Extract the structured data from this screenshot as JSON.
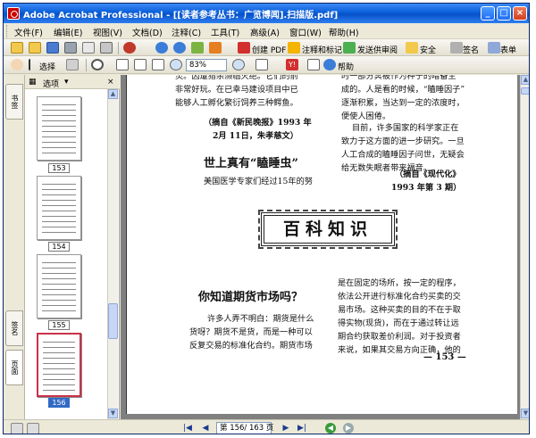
{
  "window": {
    "title": "Adobe Acrobat Professional - [[读者参考丛书：广览博闻].扫描版.pdf]",
    "controls": {
      "minimize": "_",
      "maximize": "□",
      "close": "×"
    }
  },
  "menubar": {
    "items": [
      "文件(F)",
      "编辑(E)",
      "视图(V)",
      "文档(D)",
      "注释(C)",
      "工具(T)",
      "高级(A)",
      "窗口(W)",
      "帮助(H)"
    ]
  },
  "toolbar1": {
    "create_pdf": "创建 PDF",
    "comment_markup": "注释和标记",
    "send_review": "发送供审阅",
    "security": "安全",
    "sign": "签名",
    "forms": "表单"
  },
  "toolbar2": {
    "select_label": "选择",
    "zoom": "83%",
    "help_label": "帮助"
  },
  "sidebar": {
    "tabs": [
      "书签",
      "签名",
      "页面"
    ],
    "options_label": "选项",
    "close": "×",
    "thumbnails": [
      {
        "label": "153"
      },
      {
        "label": "154"
      },
      {
        "label": "155"
      },
      {
        "label": "156",
        "selected": true
      }
    ]
  },
  "document": {
    "left_column_top": [
      "灵。因遭猎杀濒临灭绝。它们的前",
      "非常好玩。在已幸马建设项目中已",
      "能够人工孵化繁衍饲养三种鳄鱼。"
    ],
    "left_source_1": "（摘自《新民晚报》1993 年",
    "left_source_2": "2月 11日，朱孝慈文）",
    "heading_1": "世上真有“瞌睡虫”",
    "subline_1": "美国医学专家们经过15年的努",
    "right_column_top": [
      "时一部分冥被作为种子的暗备生",
      "成的。人是看的时候，“瞌睡因子”",
      "逐渐积累，当达到一定的浓度时，",
      "便使人困倦。"
    ],
    "right_para": [
      "目前，许多国家的科学家正在",
      "致力于这方面的进一步研究。一旦",
      "人工合成的瞌睡因子问世，无疑会",
      "给无数失眠者带来福音。"
    ],
    "right_source_1": "（摘自《现代化》",
    "right_source_2": "1993 年第 3 期）",
    "section_box": "百科知识",
    "heading_2": "你知道期货市场吗？",
    "left_bottom": [
      "许多人弄不明白：期货是什么",
      "货呀？期货不是货，而是一种可以",
      "反复交易的标准化合约。期货市场"
    ],
    "right_bottom": [
      "是在固定的场所，按一定的程序，",
      "依法公开进行标准化合约买卖的交",
      "易市场。这种买卖的目的不在于取",
      "得实物(现货)，而在于通过转让远",
      "期合约获取差价利润。对于投资者",
      "来说，如果其交易方向正确，他的"
    ],
    "page_number": "— 153 —"
  },
  "statusbar": {
    "page_indicator": "第 156/ 163 页"
  }
}
